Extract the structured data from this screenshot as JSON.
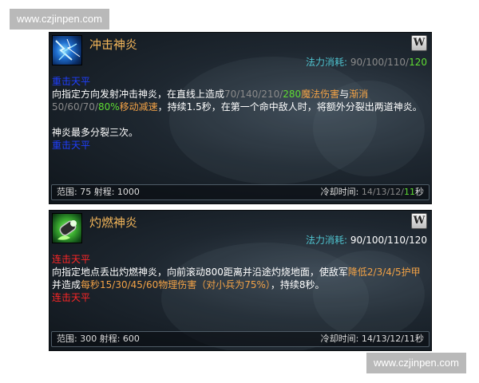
{
  "watermarks": {
    "top": "www.czjinpen.com",
    "bottom": "www.czjinpen.com"
  },
  "skills": [
    {
      "name": "冲击神炎",
      "hotkey": "W",
      "cost_label": "法力消耗:",
      "cost_values": [
        "90",
        "100",
        "110",
        "120"
      ],
      "tag_top": "重击天平",
      "desc": {
        "p1_a": "向指定方向发射冲击神炎，在直线上造成",
        "p1_dmg": [
          "70",
          "140",
          "210",
          "280"
        ],
        "p1_dmg_type": "魔法伤害",
        "p1_b": "与",
        "p1_slow_pre": "渐消",
        "p1_slow_vals": [
          "50",
          "60",
          "70",
          "80%"
        ],
        "p1_slow_type": "移动减速",
        "p1_c": "，持续1.5秒，在第一个命中敌人时，将额外分裂出两道神炎。",
        "p2": "神炎最多分裂三次。"
      },
      "tag_bottom": "重击天平",
      "footer": {
        "range": "范围: 75 射程: 1000",
        "cd_label": "冷却时间:",
        "cd_values": [
          "14",
          "13",
          "12",
          "11"
        ],
        "cd_unit": "秒"
      }
    },
    {
      "name": "灼燃神炎",
      "hotkey": "W",
      "cost_label": "法力消耗:",
      "cost_text": "90/100/110/120",
      "tag_top": "连击天平",
      "desc": {
        "a": "向指定地点丢出灼燃神炎，向前滚动800距离并沿途灼烧地面，使敌军",
        "armor": "降低2/3/4/5护甲",
        "b": "并造成",
        "dmg": "每秒15/30/45/60物理伤害（对小兵为75%）",
        "c": "，持续8秒。"
      },
      "tag_bottom": "连击天平",
      "footer": {
        "range": "范围: 300 射程: 600",
        "cd_label": "冷却时间:",
        "cd_text": "14/13/12/11秒"
      }
    }
  ],
  "colors": {
    "skill_name": "#f3b65a",
    "cost_label": "#4fc3cf",
    "highlight_green": "#5fdc33",
    "highlight_orange": "#f2a246",
    "tag_blue": "#1f3fff",
    "tag_red": "#ff2626"
  }
}
